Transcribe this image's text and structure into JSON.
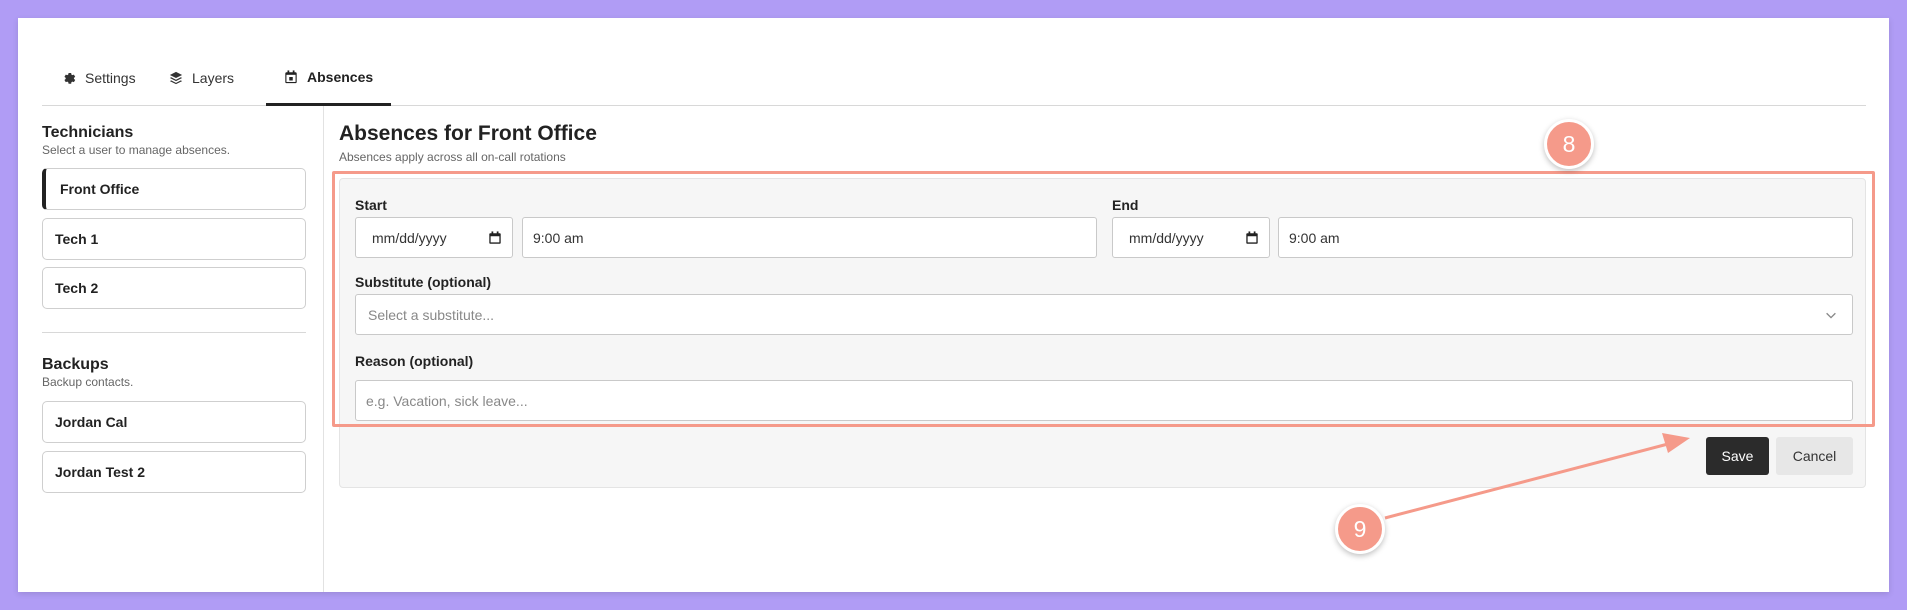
{
  "tabs": [
    {
      "label": "Settings",
      "icon": "gear-icon"
    },
    {
      "label": "Layers",
      "icon": "layers-icon"
    },
    {
      "label": "Absences",
      "icon": "calendar-icon"
    }
  ],
  "sidebar": {
    "technicians_title": "Technicians",
    "technicians_subtitle": "Select a user to manage absences.",
    "technicians": [
      "Front Office",
      "Tech 1",
      "Tech 2"
    ],
    "backups_title": "Backups",
    "backups_subtitle": "Backup contacts.",
    "backups": [
      "Jordan Cal",
      "Jordan Test 2"
    ]
  },
  "main": {
    "title": "Absences for Front Office",
    "subtitle": "Absences apply across all on-call rotations",
    "start_label": "Start",
    "start_date": "mm/dd/yyyy",
    "start_time": "9:00 am",
    "end_label": "End",
    "end_date": "mm/dd/yyyy",
    "end_time": "9:00 am",
    "substitute_label": "Substitute (optional)",
    "substitute_placeholder": "Select a substitute...",
    "reason_label": "Reason (optional)",
    "reason_placeholder": "e.g. Vacation, sick leave...",
    "save_label": "Save",
    "cancel_label": "Cancel"
  },
  "annotations": {
    "step_8": "8",
    "step_9": "9",
    "color": "#f59a8a"
  },
  "colors": {
    "background": "#b09cf5",
    "primary_button": "#2b2b2b"
  }
}
